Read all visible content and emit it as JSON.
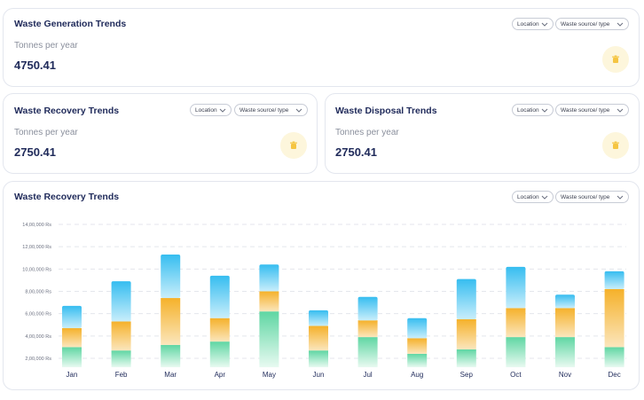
{
  "cards": {
    "generation": {
      "title": "Waste Generation Trends",
      "subtitle": "Tonnes per year",
      "value": "4750.41"
    },
    "recovery": {
      "title": "Waste Recovery Trends",
      "subtitle": "Tonnes per year",
      "value": "2750.41"
    },
    "disposal": {
      "title": "Waste Disposal Trends",
      "subtitle": "Tonnes per year",
      "value": "2750.41"
    }
  },
  "filters": {
    "location": "Location",
    "source": "Waste source/ type"
  },
  "chart_card": {
    "title": "Waste Recovery Trends"
  },
  "icons": {
    "stat_icon": "trash-icon",
    "dropdown_icon": "chevron-down-icon"
  },
  "colors": {
    "accent_bubble": "#fdf6dc",
    "icon": "#f5c542",
    "green": "#7ee0b5",
    "orange": "#f5b731",
    "blue": "#3fc2f0"
  },
  "chart_data": {
    "type": "bar",
    "stacked": true,
    "categories": [
      "Jan",
      "Feb",
      "Mar",
      "Apr",
      "May",
      "Jun",
      "Jul",
      "Aug",
      "Sep",
      "Oct",
      "Nov",
      "Dec"
    ],
    "y_ticks": [
      "2,00,000 Rs",
      "4,00,000 Rs",
      "6,00,000 Rs",
      "8,00,000 Rs",
      "10,00,000 Rs",
      "12,00,000 Rs",
      "14,00,000 Rs"
    ],
    "ylim": [
      100000,
      1400000
    ],
    "grid": true,
    "series": [
      {
        "color": "#7ee0b5",
        "values": [
          300000,
          270000,
          320000,
          350000,
          620000,
          270000,
          390000,
          240000,
          280000,
          390000,
          390000,
          300000
        ]
      },
      {
        "color": "#f5b731",
        "values": [
          470000,
          530000,
          740000,
          560000,
          800000,
          490000,
          540000,
          380000,
          550000,
          650000,
          650000,
          820000
        ]
      },
      {
        "color": "#3fc2f0",
        "values": [
          670000,
          890000,
          1130000,
          940000,
          1040000,
          630000,
          750000,
          560000,
          910000,
          1020000,
          770000,
          980000
        ]
      }
    ]
  }
}
